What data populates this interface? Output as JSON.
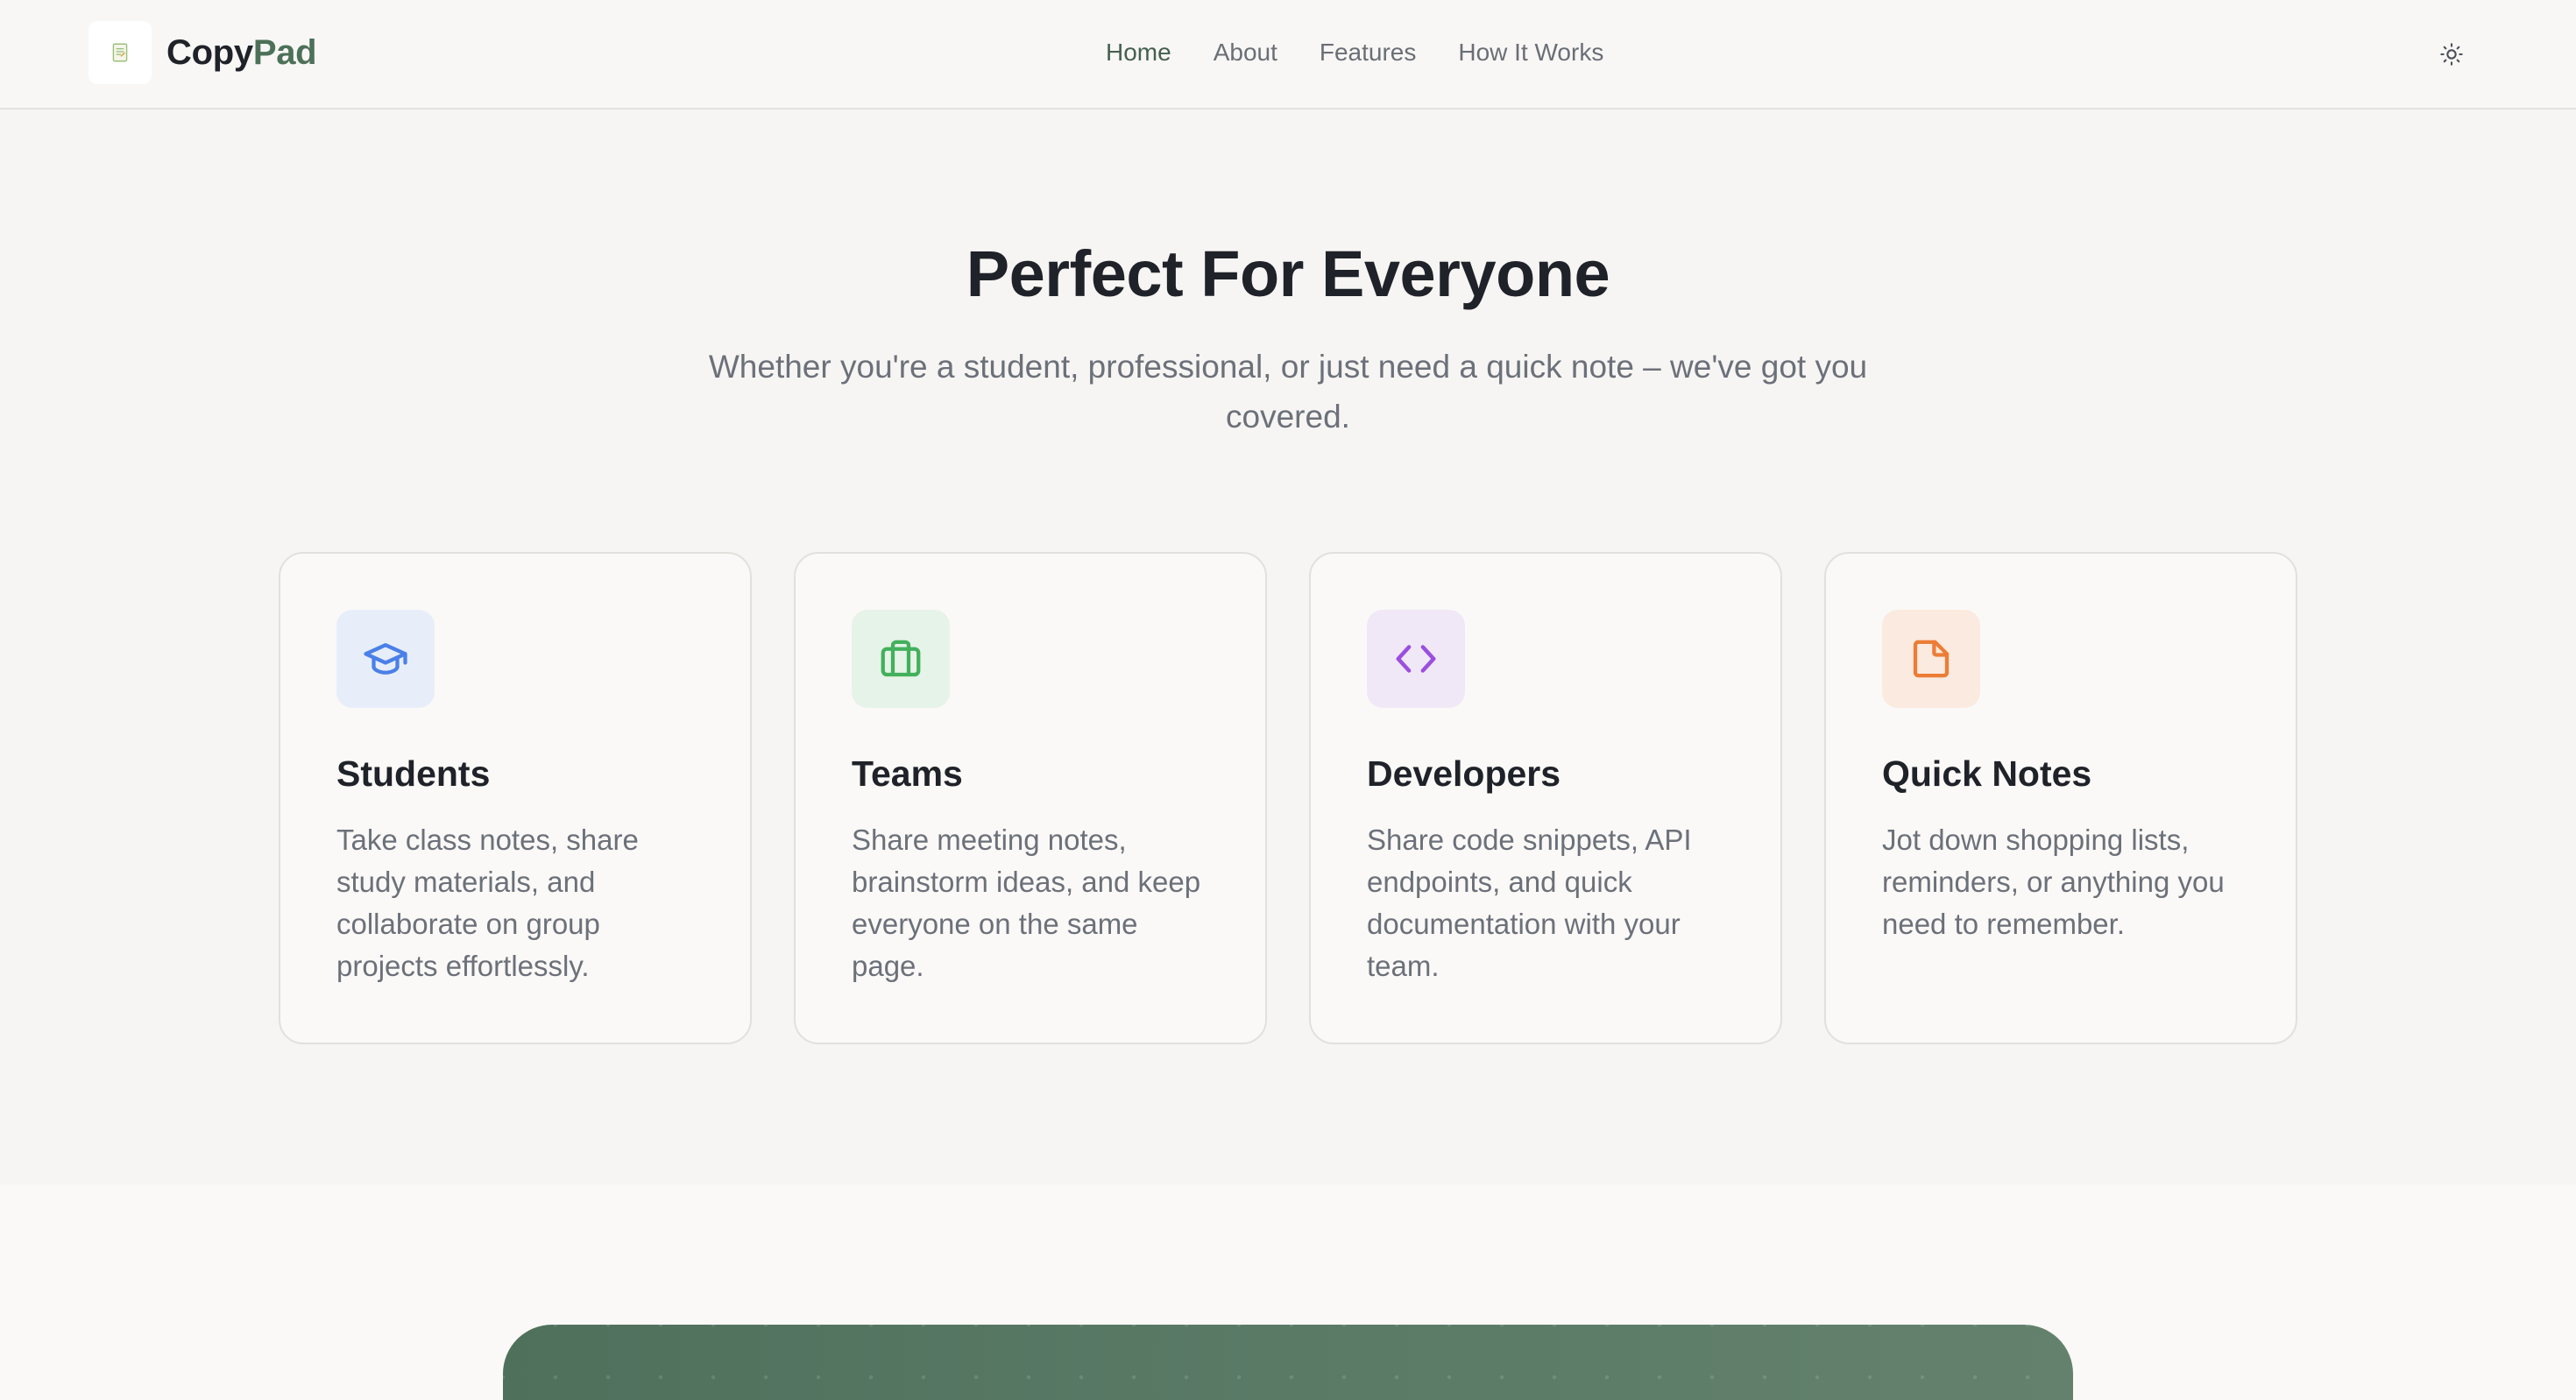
{
  "header": {
    "brand": {
      "name_part1": "Copy",
      "name_part2": "Pad",
      "logo_icon": "notepad-icon"
    },
    "nav": [
      {
        "label": "Home",
        "active": true
      },
      {
        "label": "About",
        "active": false
      },
      {
        "label": "Features",
        "active": false
      },
      {
        "label": "How It Works",
        "active": false
      }
    ],
    "theme_toggle_icon": "sun-icon"
  },
  "hero": {
    "title": "Perfect For Everyone",
    "subtitle": "Whether you're a student, professional, or just need a quick note – we've got you covered."
  },
  "cards": [
    {
      "icon": "graduation-cap-icon",
      "title": "Students",
      "description": "Take class notes, share study materials, and collaborate on group projects effortlessly.",
      "icon_color": "#4a80e8",
      "icon_bg": "#e8eef9"
    },
    {
      "icon": "briefcase-icon",
      "title": "Teams",
      "description": "Share meeting notes, brainstorm ideas, and keep everyone on the same page.",
      "icon_color": "#43b05c",
      "icon_bg": "#e6f3e8"
    },
    {
      "icon": "code-icon",
      "title": "Developers",
      "description": "Share code snippets, API endpoints, and quick documentation with your team.",
      "icon_color": "#9a4fe0",
      "icon_bg": "#f1e8f7"
    },
    {
      "icon": "sticky-note-icon",
      "title": "Quick Notes",
      "description": "Jot down shopping lists, reminders, or anything you need to remember.",
      "icon_color": "#ec7d36",
      "icon_bg": "#fbeadf"
    }
  ],
  "colors": {
    "brand_accent": "#4d7059",
    "page_bg": "#f6f5f3",
    "card_bg": "#faf9f7",
    "cta_banner": "#547560"
  }
}
